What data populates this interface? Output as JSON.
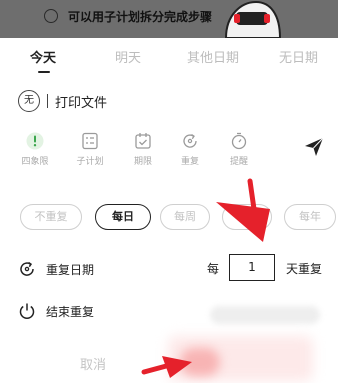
{
  "background_task": {
    "text": "可以用子计划拆分完成步骤"
  },
  "date_tabs": [
    "今天",
    "明天",
    "其他日期",
    "无日期"
  ],
  "title": {
    "badge": "无",
    "text": "打印文件"
  },
  "tools": [
    {
      "icon": "exclamation-icon",
      "label": "四象限"
    },
    {
      "icon": "checklist-icon",
      "label": "子计划"
    },
    {
      "icon": "calendar-check-icon",
      "label": "期限"
    },
    {
      "icon": "repeat-icon",
      "label": "重复"
    },
    {
      "icon": "stopwatch-icon",
      "label": "提醒"
    }
  ],
  "frequency_options": [
    "不重复",
    "每日",
    "每周",
    "每月",
    "每年"
  ],
  "selected_frequency": "每日",
  "repeat_date": {
    "label": "重复日期",
    "prefix": "每",
    "interval": "1",
    "suffix": "天重复"
  },
  "end_repeat": {
    "label": "结束重复"
  },
  "actions": {
    "cancel": "取消"
  },
  "colors": {
    "accent_red": "#e5212b",
    "text_dark": "#222222",
    "text_muted": "#bdbdbd"
  }
}
